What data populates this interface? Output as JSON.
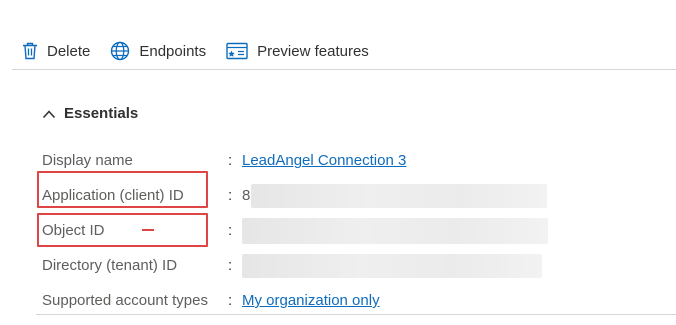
{
  "toolbar": {
    "delete_label": "Delete",
    "endpoints_label": "Endpoints",
    "preview_label": "Preview features"
  },
  "essentials": {
    "title": "Essentials"
  },
  "properties": {
    "display_name": {
      "label": "Display name",
      "value": "LeadAngel Connection 3"
    },
    "application_id": {
      "label": "Application (client) ID",
      "value_prefix": "8"
    },
    "object_id": {
      "label": "Object ID"
    },
    "directory_id": {
      "label": "Directory (tenant) ID"
    },
    "account_types": {
      "label": "Supported account types",
      "value": "My organization only"
    },
    "separator": ":"
  },
  "colors": {
    "link": "#0f6cbd",
    "highlight": "#e04545",
    "icon": "#0f6cbd"
  },
  "icons": {
    "delete": "trash-icon",
    "endpoints": "globe-icon",
    "preview": "preview-features-icon",
    "essentials": "chevron-up-icon"
  }
}
